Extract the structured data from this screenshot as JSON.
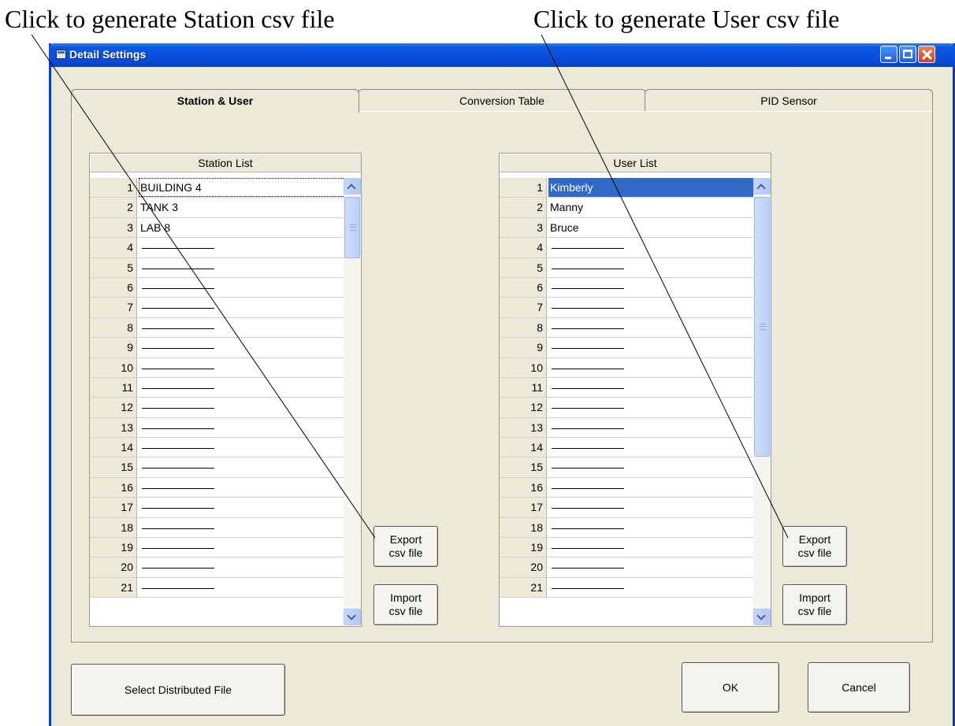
{
  "annotations": {
    "station_export": "Click to generate Station csv file",
    "user_export": "Click to generate User csv file"
  },
  "window": {
    "title": "Detail Settings",
    "controls": [
      "minimize-icon",
      "maximize-icon",
      "close-icon"
    ]
  },
  "tabs": [
    {
      "label": "Station & User",
      "active": true
    },
    {
      "label": "Conversion Table",
      "active": false
    },
    {
      "label": "PID Sensor",
      "active": false
    }
  ],
  "station_list": {
    "header": "Station List",
    "rows": [
      {
        "num": "1",
        "value": "BUILDING 4"
      },
      {
        "num": "2",
        "value": "TANK 3"
      },
      {
        "num": "3",
        "value": "LAB 8"
      },
      {
        "num": "4",
        "value": ""
      },
      {
        "num": "5",
        "value": ""
      },
      {
        "num": "6",
        "value": ""
      },
      {
        "num": "7",
        "value": ""
      },
      {
        "num": "8",
        "value": ""
      },
      {
        "num": "9",
        "value": ""
      },
      {
        "num": "10",
        "value": ""
      },
      {
        "num": "11",
        "value": ""
      },
      {
        "num": "12",
        "value": ""
      },
      {
        "num": "13",
        "value": ""
      },
      {
        "num": "14",
        "value": ""
      },
      {
        "num": "15",
        "value": ""
      },
      {
        "num": "16",
        "value": ""
      },
      {
        "num": "17",
        "value": ""
      },
      {
        "num": "18",
        "value": ""
      },
      {
        "num": "19",
        "value": ""
      },
      {
        "num": "20",
        "value": ""
      },
      {
        "num": "21",
        "value": ""
      }
    ],
    "export_label": [
      "Export",
      "csv file"
    ],
    "import_label": [
      "Import",
      "csv file"
    ]
  },
  "user_list": {
    "header": "User List",
    "rows": [
      {
        "num": "1",
        "value": "Kimberly"
      },
      {
        "num": "2",
        "value": "Manny"
      },
      {
        "num": "3",
        "value": "Bruce"
      },
      {
        "num": "4",
        "value": ""
      },
      {
        "num": "5",
        "value": ""
      },
      {
        "num": "6",
        "value": ""
      },
      {
        "num": "7",
        "value": ""
      },
      {
        "num": "8",
        "value": ""
      },
      {
        "num": "9",
        "value": ""
      },
      {
        "num": "10",
        "value": ""
      },
      {
        "num": "11",
        "value": ""
      },
      {
        "num": "12",
        "value": ""
      },
      {
        "num": "13",
        "value": ""
      },
      {
        "num": "14",
        "value": ""
      },
      {
        "num": "15",
        "value": ""
      },
      {
        "num": "16",
        "value": ""
      },
      {
        "num": "17",
        "value": ""
      },
      {
        "num": "18",
        "value": ""
      },
      {
        "num": "19",
        "value": ""
      },
      {
        "num": "20",
        "value": ""
      },
      {
        "num": "21",
        "value": ""
      }
    ],
    "export_label": [
      "Export",
      "csv file"
    ],
    "import_label": [
      "Import",
      "csv file"
    ]
  },
  "footer": {
    "select_distributed_label": "Select Distributed File",
    "ok_label": "OK",
    "cancel_label": "Cancel"
  },
  "colors": {
    "titlebar": "#0a4fd9",
    "dialog_bg": "#ece9d8",
    "selection": "#316ac5"
  }
}
